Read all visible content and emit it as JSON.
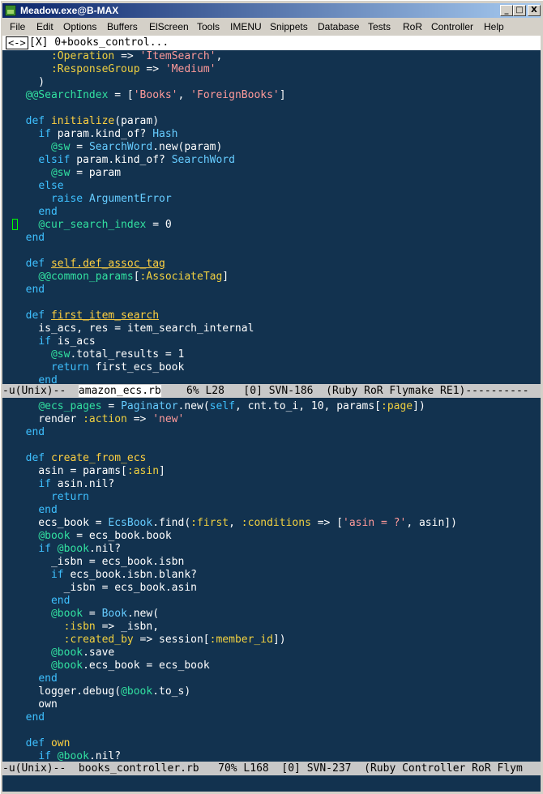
{
  "window": {
    "title": "Meadow.exe@B-MAX",
    "buttons": {
      "minimize": "_",
      "maximize": "□",
      "close": "X"
    }
  },
  "menubar": [
    "File",
    "Edit",
    "Options",
    "Buffers",
    "ElScreen",
    "Tools",
    "IMENU",
    "Snippets",
    "Database",
    "Tests",
    "RoR",
    "Controller",
    "Help"
  ],
  "tabbar": {
    "arrow": "<->",
    "label": "[X] 0+books_control..."
  },
  "colors": {
    "background": "#12324f",
    "keyword": "#3ec0ff",
    "instance_var": "#32e0a0",
    "symbol": "#f0d040",
    "string": "#ff9a9a",
    "modeline": "#c8c8c8"
  },
  "top_pane": {
    "lines": [
      [
        [
          "      ",
          ""
        ],
        [
          ":Operation",
          "sym"
        ],
        [
          " => ",
          ""
        ],
        [
          "'ItemSearch'",
          "str"
        ],
        [
          ",",
          ""
        ]
      ],
      [
        [
          "      ",
          ""
        ],
        [
          ":ResponseGroup",
          "sym"
        ],
        [
          " => ",
          ""
        ],
        [
          "'Medium'",
          "str"
        ]
      ],
      [
        [
          "    )",
          ""
        ]
      ],
      [
        [
          "  ",
          ""
        ],
        [
          "@@SearchIndex",
          "iv"
        ],
        [
          " = [",
          ""
        ],
        [
          "'Books'",
          "str"
        ],
        [
          ", ",
          ""
        ],
        [
          "'ForeignBooks'",
          "str"
        ],
        [
          "]",
          ""
        ]
      ],
      [
        [
          "",
          ""
        ]
      ],
      [
        [
          "  ",
          ""
        ],
        [
          "def",
          "kw"
        ],
        [
          " ",
          ""
        ],
        [
          "initialize",
          "fn"
        ],
        [
          "(param)",
          ""
        ]
      ],
      [
        [
          "    ",
          ""
        ],
        [
          "if",
          "kw"
        ],
        [
          " param.kind_of? ",
          ""
        ],
        [
          "Hash",
          "cls"
        ]
      ],
      [
        [
          "      ",
          ""
        ],
        [
          "@sw",
          "iv"
        ],
        [
          " = ",
          ""
        ],
        [
          "SearchWord",
          "cls"
        ],
        [
          ".new(param)",
          ""
        ]
      ],
      [
        [
          "    ",
          ""
        ],
        [
          "elsif",
          "kw"
        ],
        [
          " param.kind_of? ",
          ""
        ],
        [
          "SearchWord",
          "cls"
        ]
      ],
      [
        [
          "      ",
          ""
        ],
        [
          "@sw",
          "iv"
        ],
        [
          " = param",
          ""
        ]
      ],
      [
        [
          "    ",
          ""
        ],
        [
          "else",
          "kw"
        ]
      ],
      [
        [
          "      ",
          ""
        ],
        [
          "raise",
          "kw"
        ],
        [
          " ",
          ""
        ],
        [
          "ArgumentError",
          "cls"
        ]
      ],
      [
        [
          "    ",
          ""
        ],
        [
          "end",
          "kw"
        ]
      ],
      [
        [
          "    ",
          ""
        ],
        [
          "@cur_search_index",
          "iv"
        ],
        [
          " = 0",
          ""
        ]
      ],
      [
        [
          "  ",
          ""
        ],
        [
          "end",
          "kw"
        ]
      ],
      [
        [
          "",
          ""
        ]
      ],
      [
        [
          "  ",
          ""
        ],
        [
          "def",
          "kw"
        ],
        [
          " ",
          ""
        ],
        [
          "self.def_assoc_tag",
          "fn ul"
        ]
      ],
      [
        [
          "    ",
          ""
        ],
        [
          "@@common_params",
          "iv"
        ],
        [
          "[",
          ""
        ],
        [
          ":AssociateTag",
          "sym"
        ],
        [
          "]",
          ""
        ]
      ],
      [
        [
          "  ",
          ""
        ],
        [
          "end",
          "kw"
        ]
      ],
      [
        [
          "",
          ""
        ]
      ],
      [
        [
          "  ",
          ""
        ],
        [
          "def",
          "kw"
        ],
        [
          " ",
          ""
        ],
        [
          "first_item_search",
          "fn ul"
        ]
      ],
      [
        [
          "    is_acs, res = item_search_internal",
          ""
        ]
      ],
      [
        [
          "    ",
          ""
        ],
        [
          "if",
          "kw"
        ],
        [
          " is_acs",
          ""
        ]
      ],
      [
        [
          "      ",
          ""
        ],
        [
          "@sw",
          "iv"
        ],
        [
          ".total_results = 1",
          ""
        ]
      ],
      [
        [
          "      ",
          ""
        ],
        [
          "return",
          "kw"
        ],
        [
          " first_ecs_book",
          ""
        ]
      ],
      [
        [
          "    ",
          ""
        ],
        [
          "end",
          "kw"
        ]
      ]
    ]
  },
  "top_modeline": {
    "prefix": "-u(Unix)--  ",
    "buffer": "amazon_ecs.rb",
    "rest": "    6% L28   [0] SVN-186  (Ruby RoR Flymake RE1)----------"
  },
  "bottom_pane": {
    "lines": [
      [
        [
          "    ",
          ""
        ],
        [
          "@ecs_pages",
          "iv"
        ],
        [
          " = ",
          ""
        ],
        [
          "Paginator",
          "cls"
        ],
        [
          ".new(",
          ""
        ],
        [
          "self",
          "kw"
        ],
        [
          ", cnt.to_i, 10, params[",
          ""
        ],
        [
          ":page",
          "sym"
        ],
        [
          "])",
          ""
        ]
      ],
      [
        [
          "    render ",
          ""
        ],
        [
          ":action",
          "sym"
        ],
        [
          " => ",
          ""
        ],
        [
          "'new'",
          "str"
        ]
      ],
      [
        [
          "  ",
          ""
        ],
        [
          "end",
          "kw"
        ]
      ],
      [
        [
          "",
          ""
        ]
      ],
      [
        [
          "  ",
          ""
        ],
        [
          "def",
          "kw"
        ],
        [
          " ",
          ""
        ],
        [
          "create_from_ecs",
          "fn"
        ]
      ],
      [
        [
          "    asin = params[",
          ""
        ],
        [
          ":asin",
          "sym"
        ],
        [
          "]",
          ""
        ]
      ],
      [
        [
          "    ",
          ""
        ],
        [
          "if",
          "kw"
        ],
        [
          " asin.nil?",
          ""
        ]
      ],
      [
        [
          "      ",
          ""
        ],
        [
          "return",
          "kw"
        ]
      ],
      [
        [
          "    ",
          ""
        ],
        [
          "end",
          "kw"
        ]
      ],
      [
        [
          "    ecs_book = ",
          ""
        ],
        [
          "EcsBook",
          "cls"
        ],
        [
          ".find(",
          ""
        ],
        [
          ":first",
          "sym"
        ],
        [
          ", ",
          ""
        ],
        [
          ":conditions",
          "sym"
        ],
        [
          " => [",
          ""
        ],
        [
          "'asin = ?'",
          "str"
        ],
        [
          ", asin])",
          ""
        ]
      ],
      [
        [
          "    ",
          ""
        ],
        [
          "@book",
          "iv"
        ],
        [
          " = ecs_book.book",
          ""
        ]
      ],
      [
        [
          "    ",
          ""
        ],
        [
          "if",
          "kw"
        ],
        [
          " ",
          ""
        ],
        [
          "@book",
          "iv"
        ],
        [
          ".nil?",
          ""
        ]
      ],
      [
        [
          "      _isbn = ecs_book.isbn",
          ""
        ]
      ],
      [
        [
          "      ",
          ""
        ],
        [
          "if",
          "kw"
        ],
        [
          " ecs_book.isbn.blank?",
          ""
        ]
      ],
      [
        [
          "        _isbn = ecs_book.asin",
          ""
        ]
      ],
      [
        [
          "      ",
          ""
        ],
        [
          "end",
          "kw"
        ]
      ],
      [
        [
          "      ",
          ""
        ],
        [
          "@book",
          "iv"
        ],
        [
          " = ",
          ""
        ],
        [
          "Book",
          "cls"
        ],
        [
          ".new(",
          ""
        ]
      ],
      [
        [
          "        ",
          ""
        ],
        [
          ":isbn",
          "sym"
        ],
        [
          " => _isbn,",
          ""
        ]
      ],
      [
        [
          "        ",
          ""
        ],
        [
          ":created_by",
          "sym"
        ],
        [
          " => session[",
          ""
        ],
        [
          ":member_id",
          "sym"
        ],
        [
          "])",
          ""
        ]
      ],
      [
        [
          "      ",
          ""
        ],
        [
          "@book",
          "iv"
        ],
        [
          ".save",
          ""
        ]
      ],
      [
        [
          "      ",
          ""
        ],
        [
          "@book",
          "iv"
        ],
        [
          ".ecs_book = ecs_book",
          ""
        ]
      ],
      [
        [
          "    ",
          ""
        ],
        [
          "end",
          "kw"
        ]
      ],
      [
        [
          "    logger.debug(",
          ""
        ],
        [
          "@book",
          "iv"
        ],
        [
          ".to_s)",
          ""
        ]
      ],
      [
        [
          "    own",
          ""
        ]
      ],
      [
        [
          "  ",
          ""
        ],
        [
          "end",
          "kw"
        ]
      ],
      [
        [
          "",
          ""
        ]
      ],
      [
        [
          "  ",
          ""
        ],
        [
          "def",
          "kw"
        ],
        [
          " ",
          ""
        ],
        [
          "own",
          "fn"
        ]
      ],
      [
        [
          "    ",
          ""
        ],
        [
          "if",
          "kw"
        ],
        [
          " ",
          ""
        ],
        [
          "@book",
          "iv"
        ],
        [
          ".nil?",
          ""
        ]
      ]
    ]
  },
  "bottom_modeline": {
    "prefix": "-u(Unix)--  ",
    "buffer": "books_controller.rb",
    "rest": "   70% L168  [0] SVN-237  (Ruby Controller RoR Flym"
  }
}
